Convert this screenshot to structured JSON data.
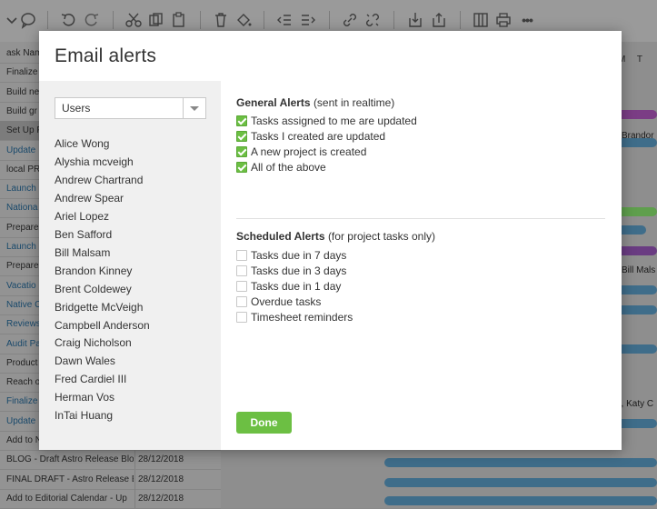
{
  "background": {
    "toolbar_icons": [
      "chevron-down-icon",
      "comment-icon",
      "undo-icon",
      "redo-icon",
      "cut-icon",
      "copy-icon",
      "paste-icon",
      "trash-icon",
      "paint-bucket-icon",
      "outdent-icon",
      "indent-icon",
      "link-icon",
      "unlink-icon",
      "import-icon",
      "export-icon",
      "columns-icon",
      "print-icon",
      "more-icon"
    ],
    "more_glyph": "•••",
    "task_rows": [
      {
        "name": "ask Nam",
        "date": ""
      },
      {
        "name": "Finalize",
        "date": ""
      },
      {
        "name": "Build ne",
        "date": ""
      },
      {
        "name": "Build gr",
        "date": ""
      },
      {
        "name": "Set Up F",
        "date": ""
      },
      {
        "name": "Update",
        "date": ""
      },
      {
        "name": "local PR",
        "date": ""
      },
      {
        "name": "Launch",
        "date": ""
      },
      {
        "name": "Nationa",
        "date": ""
      },
      {
        "name": "Prepare",
        "date": ""
      },
      {
        "name": "Launch",
        "date": ""
      },
      {
        "name": "Prepare",
        "date": ""
      },
      {
        "name": "Vacatio",
        "date": ""
      },
      {
        "name": "Native C",
        "date": ""
      },
      {
        "name": "Reviews",
        "date": ""
      },
      {
        "name": "Audit Pa",
        "date": ""
      },
      {
        "name": "Product",
        "date": ""
      },
      {
        "name": "Reach o",
        "date": ""
      },
      {
        "name": "Finalize",
        "date": ""
      },
      {
        "name": "Update",
        "date": ""
      },
      {
        "name": "Add to N",
        "date": ""
      },
      {
        "name": "BLOG - Draft Astro Release Blo",
        "date": "28/12/2018"
      },
      {
        "name": "FINAL DRAFT - Astro Release E",
        "date": "28/12/2018"
      },
      {
        "name": "Add to Editorial Calendar - Up",
        "date": "28/12/2018"
      }
    ],
    "gantt_header": "M  T",
    "gantt_labels": [
      "Brandor",
      "Bill Mals",
      "n, Katy C"
    ]
  },
  "modal": {
    "title": "Email alerts",
    "user_select": {
      "value": "Users"
    },
    "users": [
      "Alice Wong",
      "Alyshia mcveigh",
      "Andrew Chartrand",
      "Andrew Spear",
      "Ariel Lopez",
      "Ben Safford",
      "Bill Malsam",
      "Brandon Kinney",
      "Brent Coldewey",
      "Bridgette McVeigh",
      "Campbell Anderson",
      "Craig Nicholson",
      "Dawn Wales",
      "Fred Cardiel III",
      "Herman Vos",
      "InTai Huang"
    ],
    "general": {
      "title": "General Alerts",
      "subtitle": "(sent in realtime)",
      "options": [
        {
          "label": "Tasks assigned to me are updated",
          "checked": true
        },
        {
          "label": "Tasks I created are updated",
          "checked": true
        },
        {
          "label": "A new project is created",
          "checked": true
        },
        {
          "label": "All of the above",
          "checked": true
        }
      ]
    },
    "scheduled": {
      "title": "Scheduled Alerts",
      "subtitle": "(for project tasks only)",
      "options": [
        {
          "label": "Tasks due in 7 days",
          "checked": false
        },
        {
          "label": "Tasks due in 3 days",
          "checked": false
        },
        {
          "label": "Tasks due in 1 day",
          "checked": false
        },
        {
          "label": "Overdue tasks",
          "checked": false
        },
        {
          "label": "Timesheet reminders",
          "checked": false
        }
      ]
    },
    "done_label": "Done",
    "colors": {
      "accent_green": "#6cbf43",
      "sidebar_bg": "#f0f0f0"
    }
  }
}
